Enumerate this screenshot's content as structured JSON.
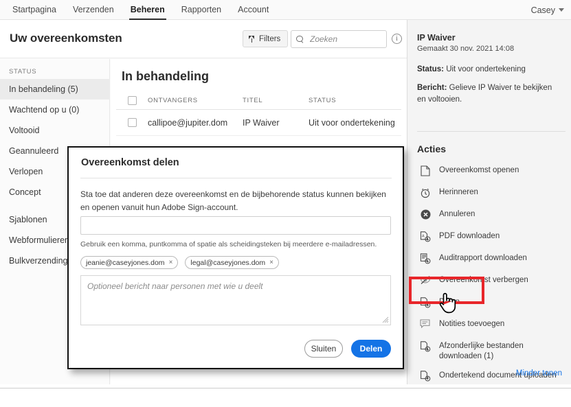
{
  "topnav": {
    "items": [
      {
        "label": "Startpagina",
        "active": false
      },
      {
        "label": "Verzenden",
        "active": false
      },
      {
        "label": "Beheren",
        "active": true
      },
      {
        "label": "Rapporten",
        "active": false
      },
      {
        "label": "Account",
        "active": false
      }
    ],
    "user": "Casey"
  },
  "header": {
    "title": "Uw overeenkomsten",
    "filters_label": "Filters",
    "search_placeholder": "Zoeken",
    "search_value": "",
    "info_glyph": "i"
  },
  "sidebar": {
    "label": "STATUS",
    "items": [
      {
        "label": "In behandeling (5)",
        "selected": true
      },
      {
        "label": "Wachtend op u (0)",
        "selected": false
      },
      {
        "label": "Voltooid",
        "selected": false
      },
      {
        "label": "Geannuleerd",
        "selected": false
      },
      {
        "label": "Verlopen",
        "selected": false
      },
      {
        "label": "Concept",
        "selected": false
      }
    ],
    "items2": [
      {
        "label": "Sjablonen",
        "selected": false
      },
      {
        "label": "Webformulieren",
        "selected": false
      },
      {
        "label": "Bulkverzendingen",
        "selected": false
      }
    ]
  },
  "main": {
    "title": "In behandeling",
    "columns": [
      "ONTVANGERS",
      "TITEL",
      "STATUS"
    ],
    "rows": [
      {
        "recipient": "callipoe@jupiter.dom",
        "title": "IP Waiver",
        "status": "Uit voor ondertekening"
      }
    ]
  },
  "rightpanel": {
    "doc_title": "IP Waiver",
    "created": "Gemaakt 30 nov. 2021 14:08",
    "status_label": "Status:",
    "status_value": "Uit voor ondertekening",
    "message_label": "Bericht:",
    "message_value": "Gelieve IP Waiver te bekijken en voltooien.",
    "actions_title": "Acties",
    "actions": [
      {
        "label": "Overeenkomst openen",
        "icon": "document-icon"
      },
      {
        "label": "Herinneren",
        "icon": "alarm-clock-icon"
      },
      {
        "label": "Annuleren",
        "icon": "cancel-circle-icon"
      },
      {
        "label": "PDF downloaden",
        "icon": "pdf-download-icon"
      },
      {
        "label": "Auditrapport downloaden",
        "icon": "report-download-icon"
      },
      {
        "label": "Overeenkomst verbergen",
        "icon": "eye-off-icon"
      },
      {
        "label": "Delen",
        "icon": "share-document-icon"
      },
      {
        "label": "Notities toevoegen",
        "icon": "comment-icon"
      },
      {
        "label": "Afzonderlijke bestanden downloaden (1)",
        "icon": "file-download-icon"
      },
      {
        "label": "Ondertekend document uploaden",
        "icon": "file-upload-icon"
      }
    ],
    "less_link": "Minder tonen",
    "link_color": "#1473e6",
    "highlight_color": "#e8262a",
    "highlighted_action": "Delen"
  },
  "modal": {
    "title": "Overeenkomst delen",
    "description": "Sta toe dat anderen deze overeenkomst en de bijbehorende status kunnen bekijken en openen vanuit hun Adobe Sign-account.",
    "email_value": "",
    "email_placeholder": "",
    "hint": "Gebruik een komma, puntkomma of spatie als scheidingsteken bij meerdere e-mailadressen.",
    "chips": [
      {
        "label": "jeanie@caseyjones.dom",
        "remove": "×"
      },
      {
        "label": "legal@caseyjones.dom",
        "remove": "×"
      }
    ],
    "message_placeholder": "Optioneel bericht naar personen met wie u deelt",
    "message_value": "",
    "cancel_label": "Sluiten",
    "submit_label": "Delen",
    "submit_color": "#1473e6"
  }
}
